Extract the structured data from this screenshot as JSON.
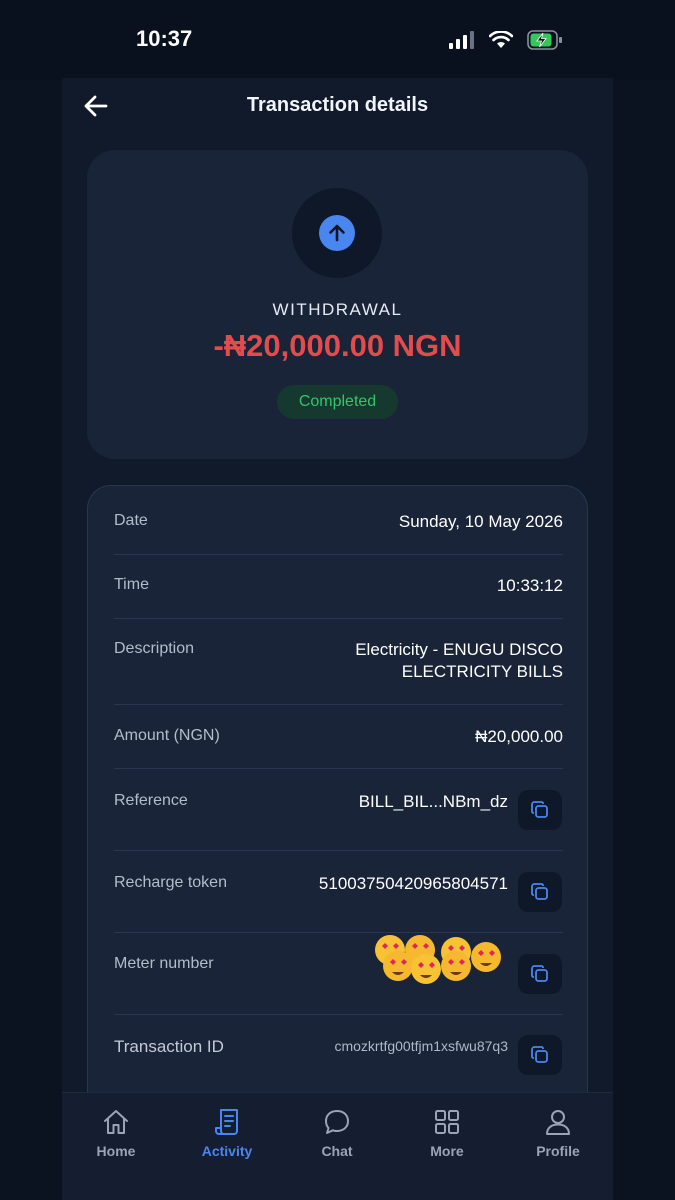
{
  "status_bar": {
    "time": "10:37"
  },
  "header": {
    "title": "Transaction details"
  },
  "summary": {
    "type": "WITHDRAWAL",
    "amount": "-₦20,000.00 NGN",
    "status": "Completed",
    "colors": {
      "amount": "#e24c4c",
      "status_text": "#35c46a",
      "accent": "#4a86f0"
    }
  },
  "details": {
    "date": {
      "label": "Date",
      "value": "Sunday, 10 May 2026"
    },
    "time": {
      "label": "Time",
      "value": "10:33:12"
    },
    "description": {
      "label": "Description",
      "value_line1": "Electricity - ENUGU DISCO",
      "value_line2": "ELECTRICITY BILLS"
    },
    "amount": {
      "label": "Amount (NGN)",
      "value": "₦20,000.00"
    },
    "reference": {
      "label": "Reference",
      "value": "BILL_BIL...NBm_dz"
    },
    "recharge_token": {
      "label": "Recharge token",
      "value": "51003750420965804571"
    },
    "meter_number": {
      "label": "Meter number"
    },
    "transaction_id": {
      "label": "Transaction ID",
      "value": "cmozkrtfg00tfjm1xsfwu87q3"
    }
  },
  "nav": {
    "items": [
      {
        "label": "Home",
        "icon": "home-icon"
      },
      {
        "label": "Activity",
        "icon": "receipt-icon",
        "active": true
      },
      {
        "label": "Chat",
        "icon": "chat-icon"
      },
      {
        "label": "More",
        "icon": "grid-icon"
      },
      {
        "label": "Profile",
        "icon": "user-icon"
      }
    ]
  }
}
